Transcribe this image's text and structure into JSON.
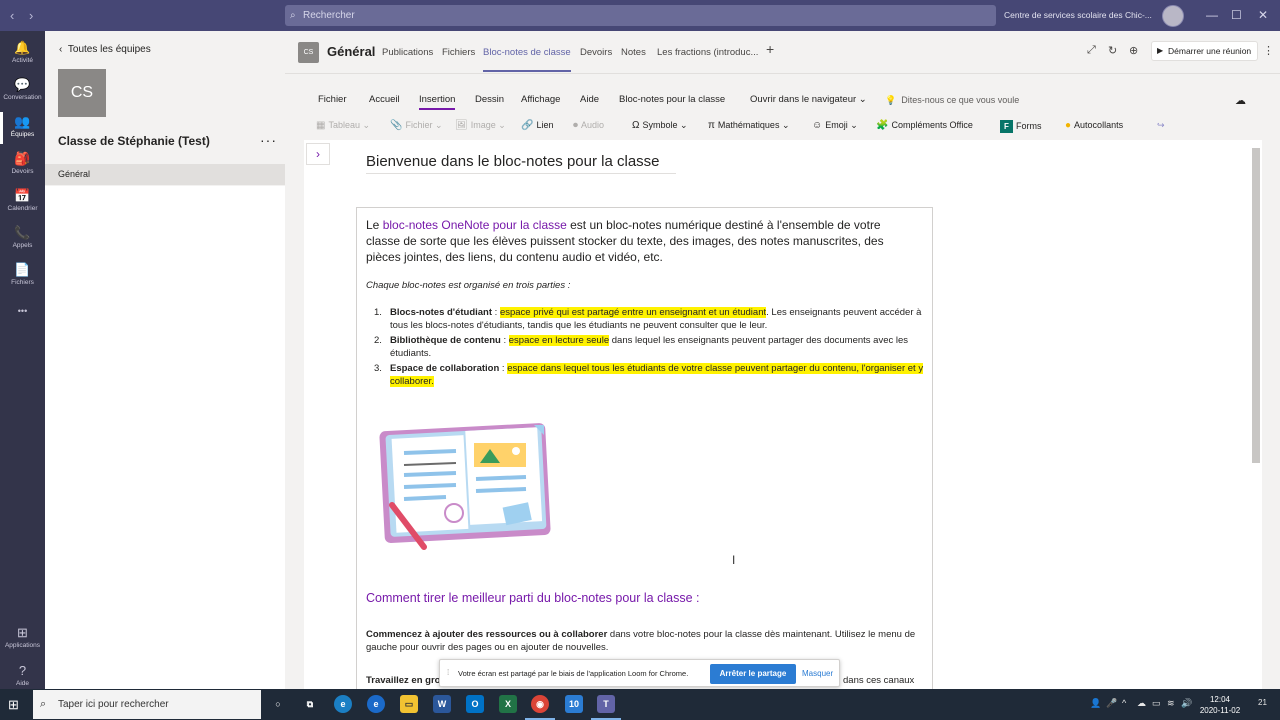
{
  "titlebar": {
    "search_placeholder": "Rechercher",
    "tenant": "Centre de services scolaire des Chic-...",
    "back_glyph": "‹",
    "forward_glyph": "›",
    "minimize_glyph": "—",
    "maximize_glyph": "☐",
    "close_glyph": "✕"
  },
  "rail": {
    "items": [
      {
        "label": "Activité",
        "icon": "bell-icon",
        "glyph": "🔔"
      },
      {
        "label": "Conversation",
        "icon": "chat-icon",
        "glyph": "💬"
      },
      {
        "label": "Équipes",
        "icon": "teams-icon",
        "glyph": "👥"
      },
      {
        "label": "Devoirs",
        "icon": "assignments-icon",
        "glyph": "🎒"
      },
      {
        "label": "Calendrier",
        "icon": "calendar-icon",
        "glyph": "📅"
      },
      {
        "label": "Appels",
        "icon": "phone-icon",
        "glyph": "📞"
      },
      {
        "label": "Fichiers",
        "icon": "files-icon",
        "glyph": "📄"
      },
      {
        "label": "",
        "icon": "more-icon",
        "glyph": "•••"
      }
    ],
    "bottom": [
      {
        "label": "Applications",
        "icon": "apps-icon",
        "glyph": "⊞"
      },
      {
        "label": "Aide",
        "icon": "help-icon",
        "glyph": "?"
      }
    ]
  },
  "teampanel": {
    "back_label": "Toutes les équipes",
    "avatar_initials": "CS",
    "team_name": "Classe de Stéphanie (Test)",
    "more": "···",
    "channel": "Général"
  },
  "channel_header": {
    "avatar": "CS",
    "title": "Général",
    "tabs": [
      {
        "label": "Publications",
        "active": false
      },
      {
        "label": "Fichiers",
        "active": false
      },
      {
        "label": "Bloc-notes de classe",
        "active": true
      },
      {
        "label": "Devoirs",
        "active": false
      },
      {
        "label": "Notes",
        "active": false
      },
      {
        "label": "Les fractions (introduc...",
        "active": false
      }
    ],
    "add_tab": "+",
    "meet_button": "Démarrer une réunion"
  },
  "ribbon": {
    "menu": [
      {
        "label": "Fichier"
      },
      {
        "label": "Accueil"
      },
      {
        "label": "Insertion",
        "active": true
      },
      {
        "label": "Dessin"
      },
      {
        "label": "Affichage"
      },
      {
        "label": "Aide"
      },
      {
        "label": "Bloc-notes pour la classe"
      },
      {
        "label": "Ouvrir dans le navigateur ⌄"
      }
    ],
    "tell_me": "Dites-nous ce que vous voule",
    "tools": [
      {
        "label": "Tableau ⌄",
        "glyph": "▦",
        "disabled": true
      },
      {
        "label": "Fichier ⌄",
        "glyph": "📎",
        "disabled": true
      },
      {
        "label": "Image ⌄",
        "glyph": "🖼",
        "disabled": true
      },
      {
        "label": "Lien",
        "glyph": "🔗",
        "disabled": false
      },
      {
        "label": "Audio",
        "glyph": "⏺",
        "disabled": true
      },
      {
        "label": "Symbole ⌄",
        "glyph": "Ω",
        "disabled": false
      },
      {
        "label": "Mathématiques ⌄",
        "glyph": "π",
        "disabled": false
      },
      {
        "label": "Emoji ⌄",
        "glyph": "☺",
        "disabled": false
      },
      {
        "label": "Compléments Office",
        "glyph": "🧩",
        "disabled": false
      },
      {
        "label": "Forms",
        "glyph": "F",
        "disabled": false
      },
      {
        "label": "Autocollants",
        "glyph": "●",
        "disabled": false
      }
    ]
  },
  "page": {
    "title": "Bienvenue dans le bloc-notes pour la classe",
    "intro_prefix": "Le ",
    "intro_link": "bloc-notes OneNote pour la classe",
    "intro_rest": " est un bloc-notes numérique destiné à l'ensemble de votre classe de sorte que les élèves puissent stocker du texte, des images, des notes manuscrites, des pièces jointes, des liens, du contenu audio et vidéo, etc.",
    "subhead": "Chaque bloc-notes est organisé en trois parties :",
    "list": [
      {
        "num": "1.",
        "term": "Blocs-notes d'étudiant",
        "sep": " : ",
        "highlight": "espace privé qui est partagé entre un enseignant et un étudiant",
        "rest": ". Les enseignants peuvent accéder à tous les blocs-notes d'étudiants, tandis que les étudiants ne peuvent consulter que le leur."
      },
      {
        "num": "2.",
        "term": "Bibliothèque de contenu",
        "sep": " : ",
        "highlight": "espace en lecture seule",
        "rest": " dans lequel les enseignants peuvent partager des documents avec les étudiants."
      },
      {
        "num": "3.",
        "term": "Espace de collaboration",
        "sep": " : ",
        "highlight": "espace dans lequel tous les étudiants de votre classe peuvent partager du contenu, l'organiser et y collaborer.",
        "rest": ""
      }
    ],
    "heading2": "Comment tirer le meilleur parti du bloc-notes pour la classe :",
    "para1_bold": "Commencez à ajouter des ressources ou à collaborer",
    "para1_rest": " dans votre bloc-notes pour la classe dès maintenant. Utilisez le menu de gauche pour ouvrir des pages ou en ajouter de nouvelles.",
    "para2_bold": "Travaillez en gro",
    "para2_rest": "dans ces canaux"
  },
  "share_banner": {
    "message": "Votre écran est partagé par le biais de l'application Loom for Chrome.",
    "stop": "Arrêter le partage",
    "hide": "Masquer"
  },
  "taskbar": {
    "search_placeholder": "Taper ici pour rechercher",
    "time": "12:04",
    "date": "2020-11-02",
    "notif_count": "21",
    "badge_count": "10"
  }
}
